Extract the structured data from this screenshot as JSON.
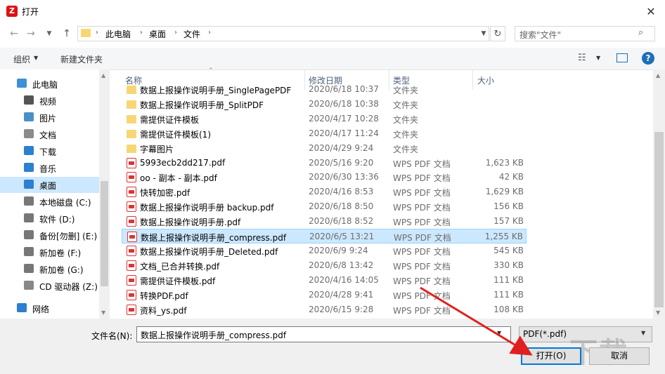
{
  "window": {
    "title": "打开",
    "app_icon_letter": "Z"
  },
  "address": {
    "crumbs": [
      "此电脑",
      "桌面",
      "文件"
    ],
    "search_placeholder": "搜索\"文件\""
  },
  "toolbar": {
    "organize": "组织",
    "new_folder": "新建文件夹"
  },
  "nav": [
    {
      "label": "此电脑",
      "icon": "computer-icon"
    },
    {
      "label": "视频",
      "icon": "video-icon"
    },
    {
      "label": "图片",
      "icon": "picture-icon"
    },
    {
      "label": "文档",
      "icon": "document-icon"
    },
    {
      "label": "下载",
      "icon": "download-icon"
    },
    {
      "label": "音乐",
      "icon": "music-icon"
    },
    {
      "label": "桌面",
      "icon": "desktop-icon",
      "selected": true
    },
    {
      "label": "本地磁盘 (C:)",
      "icon": "drive-icon"
    },
    {
      "label": "软件 (D:)",
      "icon": "drive-icon"
    },
    {
      "label": "备份[勿删] (E:)",
      "icon": "drive-icon"
    },
    {
      "label": "新加卷 (F:)",
      "icon": "drive-icon"
    },
    {
      "label": "新加卷 (G:)",
      "icon": "drive-icon"
    },
    {
      "label": "CD 驱动器 (Z:)",
      "icon": "cd-drive-icon"
    },
    {
      "label": "网络",
      "icon": "network-icon"
    }
  ],
  "columns": {
    "name": "名称",
    "date": "修改日期",
    "type": "类型",
    "size": "大小"
  },
  "files": [
    {
      "name": "数据上报操作说明手册_SinglePagePDF",
      "date": "2020/6/18 10:37",
      "type": "文件夹",
      "size": "",
      "kind": "folder"
    },
    {
      "name": "数据上报操作说明手册_SplitPDF",
      "date": "2020/6/18 10:38",
      "type": "文件夹",
      "size": "",
      "kind": "folder"
    },
    {
      "name": "需提供证件模板",
      "date": "2020/4/17 10:28",
      "type": "文件夹",
      "size": "",
      "kind": "folder"
    },
    {
      "name": "需提供证件模板(1)",
      "date": "2020/4/17 11:24",
      "type": "文件夹",
      "size": "",
      "kind": "folder"
    },
    {
      "name": "字幕图片",
      "date": "2020/4/29 9:24",
      "type": "文件夹",
      "size": "",
      "kind": "folder"
    },
    {
      "name": "5993ecb2dd217.pdf",
      "date": "2020/5/16 9:20",
      "type": "WPS PDF 文档",
      "size": "1,623 KB",
      "kind": "pdf"
    },
    {
      "name": "oo - 副本 - 副本.pdf",
      "date": "2020/6/30 13:36",
      "type": "WPS PDF 文档",
      "size": "42 KB",
      "kind": "pdf"
    },
    {
      "name": "快转加密.pdf",
      "date": "2020/4/16 8:53",
      "type": "WPS PDF 文档",
      "size": "1,629 KB",
      "kind": "pdf"
    },
    {
      "name": "数据上报操作说明手册 backup.pdf",
      "date": "2020/6/18 8:50",
      "type": "WPS PDF 文档",
      "size": "156 KB",
      "kind": "pdf"
    },
    {
      "name": "数据上报操作说明手册.pdf",
      "date": "2020/6/18 8:52",
      "type": "WPS PDF 文档",
      "size": "157 KB",
      "kind": "pdf"
    },
    {
      "name": "数据上报操作说明手册_compress.pdf",
      "date": "2020/6/5 13:21",
      "type": "WPS PDF 文档",
      "size": "1,255 KB",
      "kind": "pdf",
      "selected": true
    },
    {
      "name": "数据上报操作说明手册_Deleted.pdf",
      "date": "2020/6/9 9:24",
      "type": "WPS PDF 文档",
      "size": "545 KB",
      "kind": "pdf"
    },
    {
      "name": "文档_已合并转换.pdf",
      "date": "2020/6/8 13:42",
      "type": "WPS PDF 文档",
      "size": "330 KB",
      "kind": "pdf"
    },
    {
      "name": "需提供证件模板.pdf",
      "date": "2020/4/16 14:05",
      "type": "WPS PDF 文档",
      "size": "111 KB",
      "kind": "pdf"
    },
    {
      "name": "转换PDF.pdf",
      "date": "2020/4/28 9:41",
      "type": "WPS PDF 文档",
      "size": "111 KB",
      "kind": "pdf"
    },
    {
      "name": "资料_ys.pdf",
      "date": "2020/6/15 9:28",
      "type": "WPS PDF 文档",
      "size": "108 KB",
      "kind": "pdf"
    }
  ],
  "bottom": {
    "filename_label": "文件名(N):",
    "filename_value": "数据上报操作说明手册_compress.pdf",
    "filter": "PDF(*.pdf)",
    "open": "打开(O)",
    "cancel": "取消"
  },
  "colors": {
    "selection": "#cce8ff",
    "accent": "#0078d7",
    "arrow": "#e02020"
  }
}
